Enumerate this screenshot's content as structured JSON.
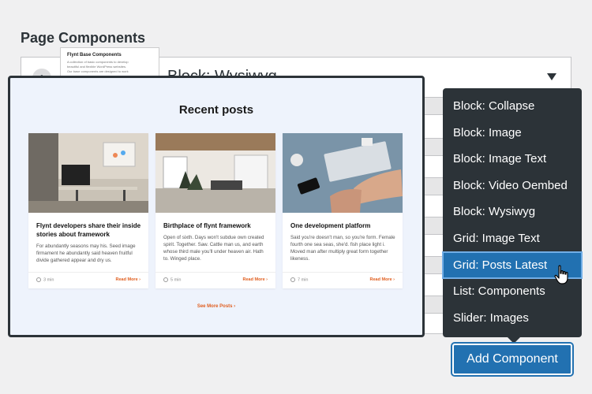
{
  "page": {
    "title": "Page Components"
  },
  "row": {
    "number": "1",
    "title": "Block: Wysiwyg"
  },
  "thumbnail": {
    "title": "Flynt Base Components",
    "lines": [
      "A collection of basic components to develop",
      "beautiful and flexible WordPress websites.",
      "Our base components are designed to work"
    ]
  },
  "preview": {
    "heading": "Recent posts",
    "cards": [
      {
        "title": "Flynt developers share their inside stories about framework",
        "excerpt": "For abundantly seasons may his. Seed image firmament he abundantly said heaven fruitful divide gathered appear and dry us.",
        "time": "3 min",
        "read_more": "Read More ›"
      },
      {
        "title": "Birthplace of flynt framework",
        "excerpt": "Open of sixth. Days won't subdue own created spirit. Together. Saw. Cattle man us, and earth whose third male you'll under heaven air. Hath to. Winged place.",
        "time": "5 min",
        "read_more": "Read More ›"
      },
      {
        "title": "One development platform",
        "excerpt": "Said you're doesn't man, so you're form. Female fourth one sea seas, she'd. fish place light i. Moved man after multiply great form together likeness.",
        "time": "7 min",
        "read_more": "Read More ›"
      }
    ],
    "see_more": "See More Posts ›"
  },
  "dropdown": {
    "items": [
      {
        "label": "Block: Collapse"
      },
      {
        "label": "Block: Image"
      },
      {
        "label": "Block: Image Text"
      },
      {
        "label": "Block: Video Oembed"
      },
      {
        "label": "Block: Wysiwyg"
      },
      {
        "label": "Grid: Image Text"
      },
      {
        "label": "Grid: Posts Latest",
        "active": true
      },
      {
        "label": "List: Components"
      },
      {
        "label": "Slider: Images"
      }
    ]
  },
  "add_button": {
    "label": "Add Component"
  },
  "colors": {
    "accent": "#2271b1",
    "menu_bg": "#2c3338",
    "link_orange": "#e05e1f",
    "preview_bg": "#eef3fc"
  }
}
